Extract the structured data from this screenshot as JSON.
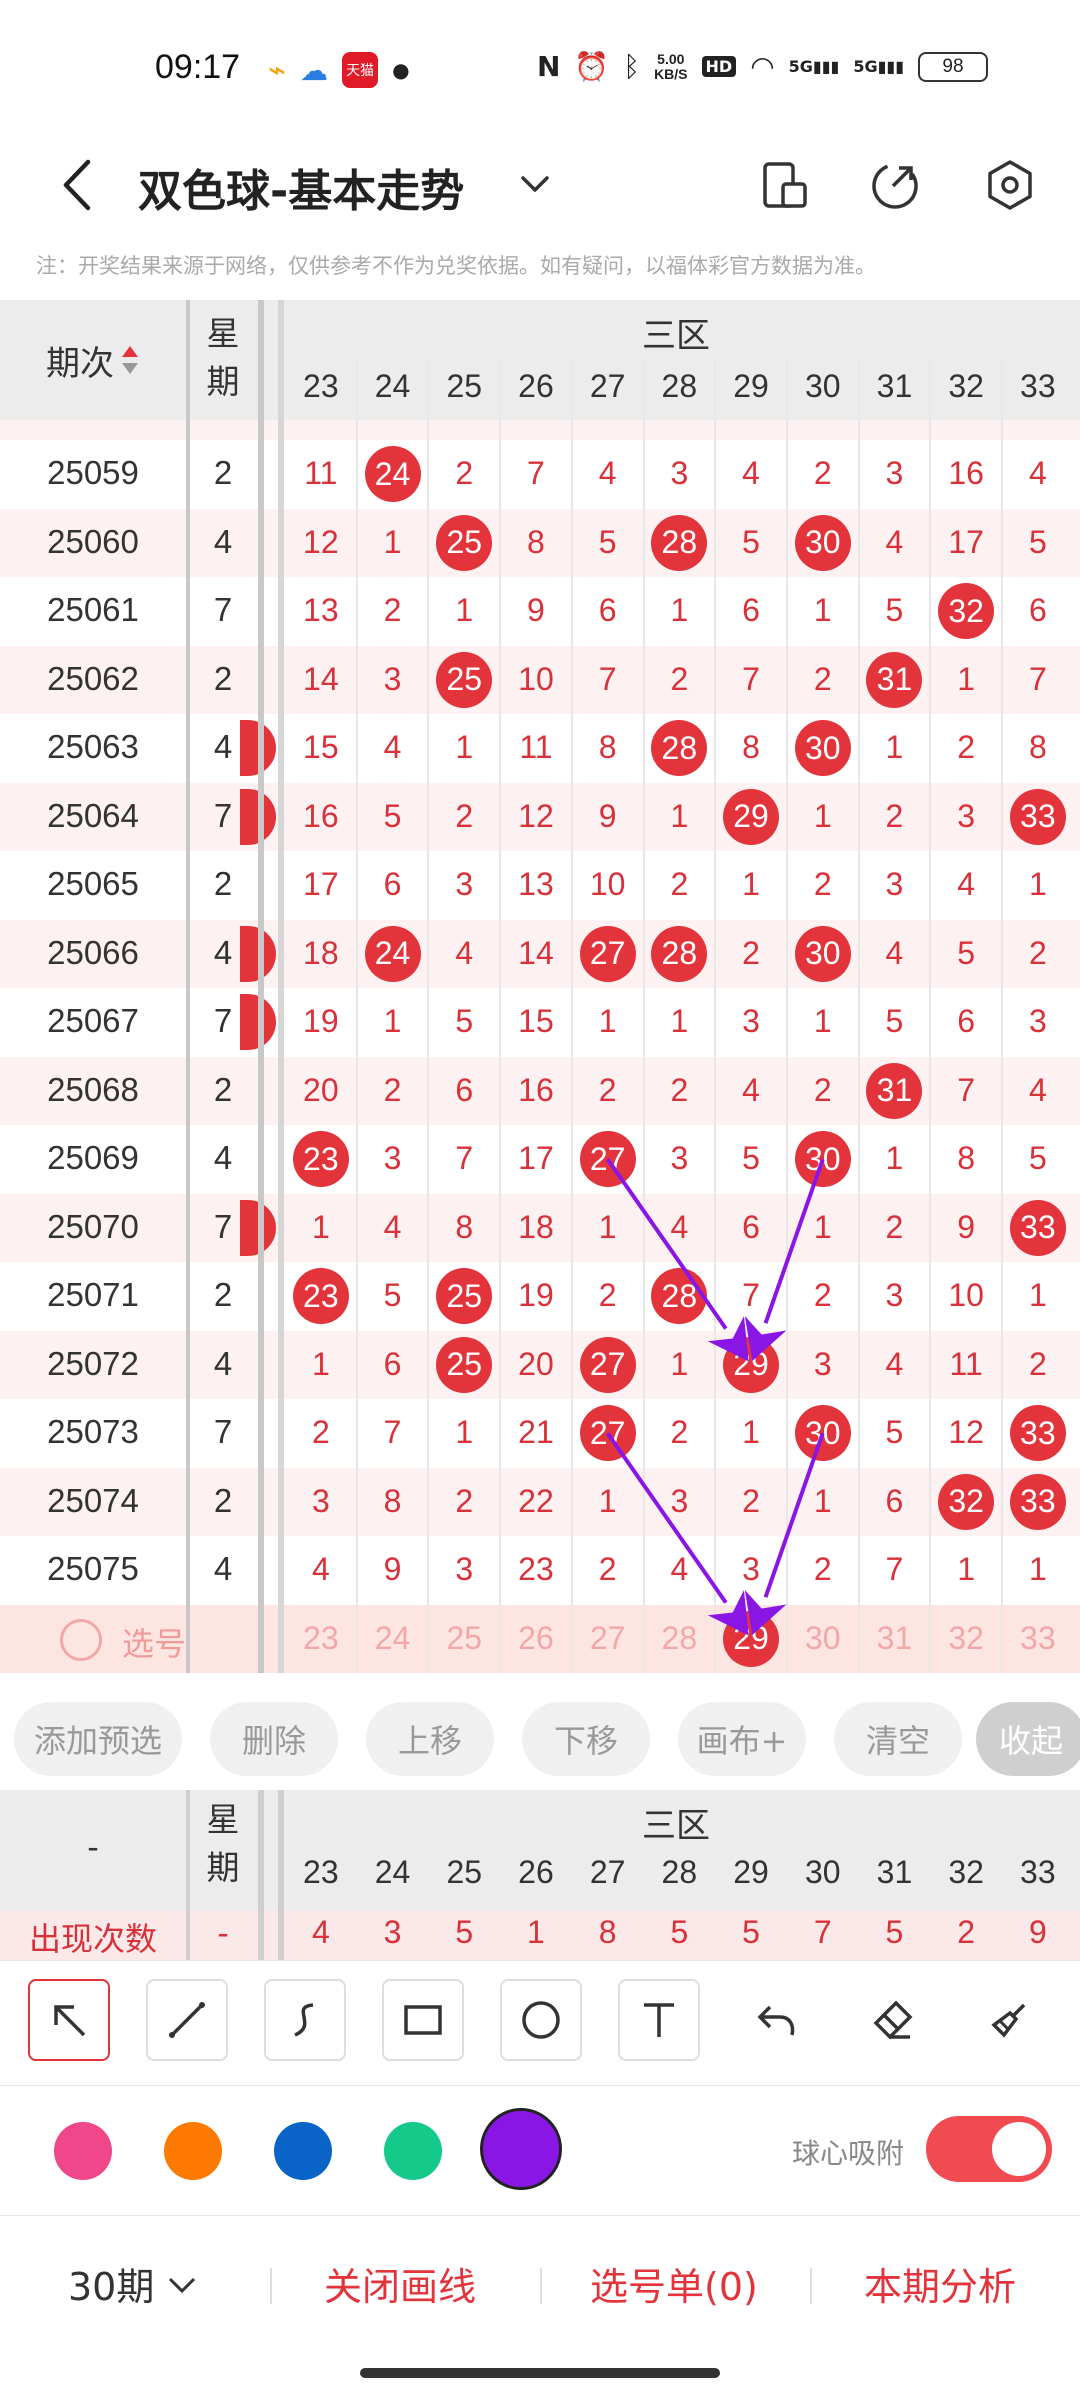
{
  "status_bar": {
    "time": "09:17",
    "net_speed_value": "5.00",
    "net_speed_unit": "KB/S",
    "hd_label": "HD",
    "sig1": "5G",
    "sig2": "5G",
    "battery": "98",
    "tmall_label": "天猫"
  },
  "header": {
    "title": "双色球-基本走势"
  },
  "notice": "注：开奖结果来源于网络，仅供参考不作为兑奖依据。如有疑问，以福体彩官方数据为准。",
  "table": {
    "issue_header": "期次",
    "week_header_1": "星",
    "week_header_2": "期",
    "zone_label": "三区",
    "columns": [
      "23",
      "24",
      "25",
      "26",
      "27",
      "28",
      "29",
      "30",
      "31",
      "32",
      "33"
    ],
    "rows": [
      {
        "issue": "25059",
        "week": "2",
        "cells": [
          "11",
          "24",
          "2",
          "7",
          "4",
          "3",
          "4",
          "2",
          "3",
          "16",
          "4"
        ],
        "balls": [
          1
        ],
        "leftball": false
      },
      {
        "issue": "25060",
        "week": "4",
        "cells": [
          "12",
          "1",
          "25",
          "8",
          "5",
          "28",
          "5",
          "30",
          "4",
          "17",
          "5"
        ],
        "balls": [
          2,
          5,
          7
        ],
        "leftball": false
      },
      {
        "issue": "25061",
        "week": "7",
        "cells": [
          "13",
          "2",
          "1",
          "9",
          "6",
          "1",
          "6",
          "1",
          "5",
          "32",
          "6"
        ],
        "balls": [
          9
        ],
        "leftball": false
      },
      {
        "issue": "25062",
        "week": "2",
        "cells": [
          "14",
          "3",
          "25",
          "10",
          "7",
          "2",
          "7",
          "2",
          "31",
          "1",
          "7"
        ],
        "balls": [
          2,
          8
        ],
        "leftball": false
      },
      {
        "issue": "25063",
        "week": "4",
        "cells": [
          "15",
          "4",
          "1",
          "11",
          "8",
          "28",
          "8",
          "30",
          "1",
          "2",
          "8"
        ],
        "balls": [
          5,
          7
        ],
        "leftball": true
      },
      {
        "issue": "25064",
        "week": "7",
        "cells": [
          "16",
          "5",
          "2",
          "12",
          "9",
          "1",
          "29",
          "1",
          "2",
          "3",
          "33"
        ],
        "balls": [
          6,
          10
        ],
        "leftball": true
      },
      {
        "issue": "25065",
        "week": "2",
        "cells": [
          "17",
          "6",
          "3",
          "13",
          "10",
          "2",
          "1",
          "2",
          "3",
          "4",
          "1"
        ],
        "balls": [],
        "leftball": false
      },
      {
        "issue": "25066",
        "week": "4",
        "cells": [
          "18",
          "24",
          "4",
          "14",
          "27",
          "28",
          "2",
          "30",
          "4",
          "5",
          "2"
        ],
        "balls": [
          1,
          4,
          5,
          7
        ],
        "leftball": true
      },
      {
        "issue": "25067",
        "week": "7",
        "cells": [
          "19",
          "1",
          "5",
          "15",
          "1",
          "1",
          "3",
          "1",
          "5",
          "6",
          "3"
        ],
        "balls": [],
        "leftball": true
      },
      {
        "issue": "25068",
        "week": "2",
        "cells": [
          "20",
          "2",
          "6",
          "16",
          "2",
          "2",
          "4",
          "2",
          "31",
          "7",
          "4"
        ],
        "balls": [
          8
        ],
        "leftball": false
      },
      {
        "issue": "25069",
        "week": "4",
        "cells": [
          "23",
          "3",
          "7",
          "17",
          "27",
          "3",
          "5",
          "30",
          "1",
          "8",
          "5"
        ],
        "balls": [
          0,
          4,
          7
        ],
        "leftball": false
      },
      {
        "issue": "25070",
        "week": "7",
        "cells": [
          "1",
          "4",
          "8",
          "18",
          "1",
          "4",
          "6",
          "1",
          "2",
          "9",
          "33"
        ],
        "balls": [
          10
        ],
        "leftball": true
      },
      {
        "issue": "25071",
        "week": "2",
        "cells": [
          "23",
          "5",
          "25",
          "19",
          "2",
          "28",
          "7",
          "2",
          "3",
          "10",
          "1"
        ],
        "balls": [
          0,
          2,
          5
        ],
        "leftball": false
      },
      {
        "issue": "25072",
        "week": "4",
        "cells": [
          "1",
          "6",
          "25",
          "20",
          "27",
          "1",
          "29",
          "3",
          "4",
          "11",
          "2"
        ],
        "balls": [
          2,
          4,
          6
        ],
        "leftball": false
      },
      {
        "issue": "25073",
        "week": "7",
        "cells": [
          "2",
          "7",
          "1",
          "21",
          "27",
          "2",
          "1",
          "30",
          "5",
          "12",
          "33"
        ],
        "balls": [
          4,
          7,
          10
        ],
        "leftball": false
      },
      {
        "issue": "25074",
        "week": "2",
        "cells": [
          "3",
          "8",
          "2",
          "22",
          "1",
          "3",
          "2",
          "1",
          "6",
          "32",
          "33"
        ],
        "balls": [
          9,
          10
        ],
        "leftball": false
      },
      {
        "issue": "25075",
        "week": "4",
        "cells": [
          "4",
          "9",
          "3",
          "23",
          "2",
          "4",
          "3",
          "2",
          "7",
          "1",
          "1"
        ],
        "balls": [],
        "leftball": false
      }
    ],
    "select_label": "选号",
    "select_cells": [
      "23",
      "24",
      "25",
      "26",
      "27",
      "28",
      "29",
      "30",
      "31",
      "32",
      "33"
    ],
    "select_ball_index": 6
  },
  "actions": {
    "add_preselect": "添加预选",
    "delete": "删除",
    "move_up": "上移",
    "move_down": "下移",
    "canvas_plus": "画布+",
    "clear": "清空",
    "collapse": "收起"
  },
  "stats": {
    "corner": "-",
    "week_1": "星",
    "week_2": "期",
    "zone_label": "三区",
    "columns": [
      "23",
      "24",
      "25",
      "26",
      "27",
      "28",
      "29",
      "30",
      "31",
      "32",
      "33"
    ],
    "row_label": "出现次数",
    "row_week": "-",
    "row_values": [
      "4",
      "3",
      "5",
      "1",
      "8",
      "5",
      "5",
      "7",
      "5",
      "2",
      "9"
    ]
  },
  "draw": {
    "snap_label": "球心吸附",
    "snap_on": true,
    "colors": [
      "#f0468a",
      "#ff7a00",
      "#0a64c8",
      "#15c98a",
      "#8a16e6"
    ],
    "selected_color": "#8a16e6"
  },
  "bottom_bar": {
    "period": "30期",
    "close_lines": "关闭画线",
    "selection_list": "选号单(0)",
    "analysis": "本期分析"
  },
  "annotation_color": "#8a16e6"
}
